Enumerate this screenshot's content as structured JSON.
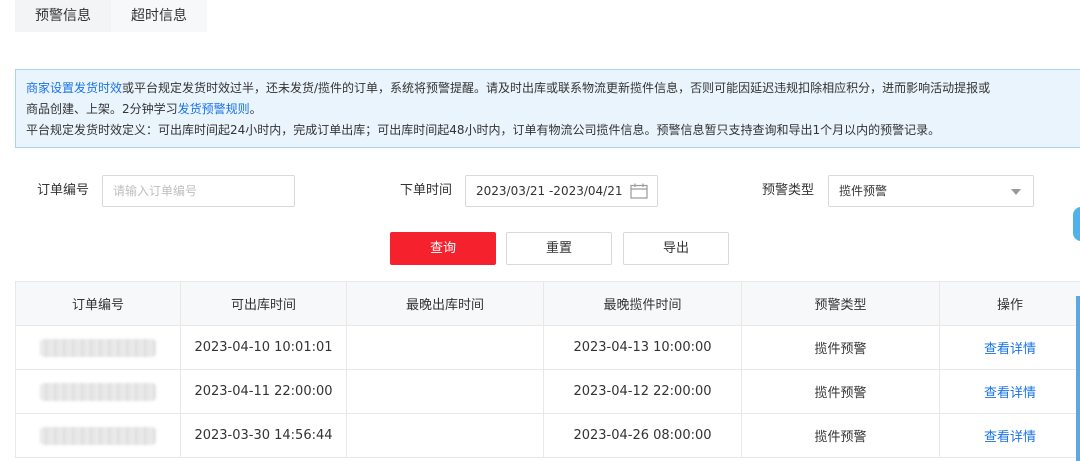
{
  "tabs": [
    {
      "label": "预警信息",
      "active": true
    },
    {
      "label": "超时信息",
      "active": false
    }
  ],
  "notice": {
    "link1": "商家设置发货时效",
    "text1": "或平台规定发货时效过半，还未发货/揽件的订单，系统将预警提醒。请及时出库或联系物流更新揽件信息，否则可能因延迟违规扣除相应积分，进而影响活动提报或",
    "text2": "商品创建、上架。2分钟学习",
    "link2": "发货预警规则",
    "text2_end": "。",
    "text3": "平台规定发货时效定义：可出库时间起24小时内，完成订单出库；可出库时间起48小时内，订单有物流公司揽件信息。预警信息暂只支持查询和导出1个月以内的预警记录。"
  },
  "filters": {
    "order_no_label": "订单编号",
    "order_no_placeholder": "请输入订单编号",
    "order_time_label": "下单时间",
    "order_time_value": "2023/03/21 -2023/04/21",
    "warn_type_label": "预警类型",
    "warn_type_value": "揽件预警"
  },
  "buttons": {
    "query": "查询",
    "reset": "重置",
    "export": "导出"
  },
  "table": {
    "headers": [
      "订单编号",
      "可出库时间",
      "最晚出库时间",
      "最晚揽件时间",
      "预警类型",
      "操作"
    ],
    "rows": [
      {
        "ship_time": "2023-04-10 10:01:01",
        "latest_out": "",
        "latest_pick": "2023-04-13 10:00:00",
        "type": "揽件预警",
        "action": "查看详情"
      },
      {
        "ship_time": "2023-04-11 22:00:00",
        "latest_out": "",
        "latest_pick": "2023-04-12 22:00:00",
        "type": "揽件预警",
        "action": "查看详情"
      },
      {
        "ship_time": "2023-03-30 14:56:44",
        "latest_out": "",
        "latest_pick": "2023-04-26 08:00:00",
        "type": "揽件预警",
        "action": "查看详情"
      }
    ]
  },
  "colors": {
    "primary": "#f5222d",
    "link": "#1a73e8",
    "notice_bg": "#eaf4fd"
  }
}
